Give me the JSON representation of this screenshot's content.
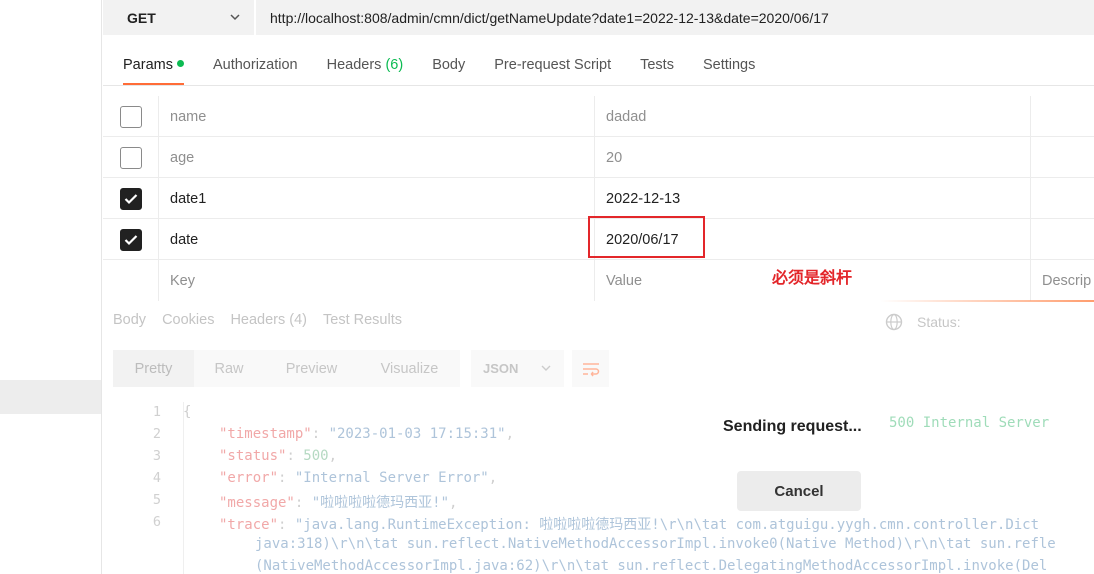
{
  "request": {
    "method": "GET",
    "url": "http://localhost:808/admin/cmn/dict/getNameUpdate?date1=2022-12-13&date=2020/06/17"
  },
  "tabs": [
    {
      "label": "Params",
      "active": true,
      "indicator": "green-dot"
    },
    {
      "label": "Authorization"
    },
    {
      "label": "Headers",
      "count": "(6)"
    },
    {
      "label": "Body"
    },
    {
      "label": "Pre-request Script"
    },
    {
      "label": "Tests"
    },
    {
      "label": "Settings"
    }
  ],
  "params": {
    "rows": [
      {
        "key": "name",
        "value": "dadad",
        "checked": false
      },
      {
        "key": "age",
        "value": "20",
        "checked": false
      },
      {
        "key": "date1",
        "value": "2022-12-13",
        "checked": true
      },
      {
        "key": "date",
        "value": "2020/06/17",
        "checked": true
      }
    ],
    "key_placeholder": "Key",
    "value_placeholder": "Value",
    "desc_placeholder": "Descrip"
  },
  "annotation": "必须是斜杆",
  "response": {
    "tabs": [
      "Body",
      "Cookies",
      "Headers (4)",
      "Test Results"
    ],
    "status_label": "Status:",
    "status_value": "500 Internal Server",
    "views": [
      "Pretty",
      "Raw",
      "Preview",
      "Visualize"
    ],
    "format": "JSON",
    "lines": [
      {
        "no": "1",
        "text": "{"
      },
      {
        "no": "2",
        "key": "\"timestamp\"",
        "val": "\"2023-01-03 17:15:31\"",
        "end": ","
      },
      {
        "no": "3",
        "key": "\"status\"",
        "num": "500",
        "end": ","
      },
      {
        "no": "4",
        "key": "\"error\"",
        "val": "\"Internal Server Error\"",
        "end": ","
      },
      {
        "no": "5",
        "key": "\"message\"",
        "val": "\"啦啦啦啦德玛西亚!\"",
        "end": ","
      },
      {
        "no": "6",
        "key": "\"trace\"",
        "val": "\"java.lang.RuntimeException: 啦啦啦啦德玛西亚!\\r\\n\\tat com.atguigu.yygh.cmn.controller.Dict"
      },
      {
        "no": "",
        "cont": "java:318)\\r\\n\\tat sun.reflect.NativeMethodAccessorImpl.invoke0(Native Method)\\r\\n\\tat sun.refle"
      },
      {
        "no": "",
        "cont": "(NativeMethodAccessorImpl.java:62)\\r\\n\\tat sun.reflect.DelegatingMethodAccessorImpl.invoke(Del"
      }
    ]
  },
  "overlay": {
    "sending_text": "Sending request...",
    "cancel_label": "Cancel"
  },
  "colors": {
    "accent": "#ff6c37",
    "success": "#0cbb52",
    "annotation": "#e3262a"
  }
}
